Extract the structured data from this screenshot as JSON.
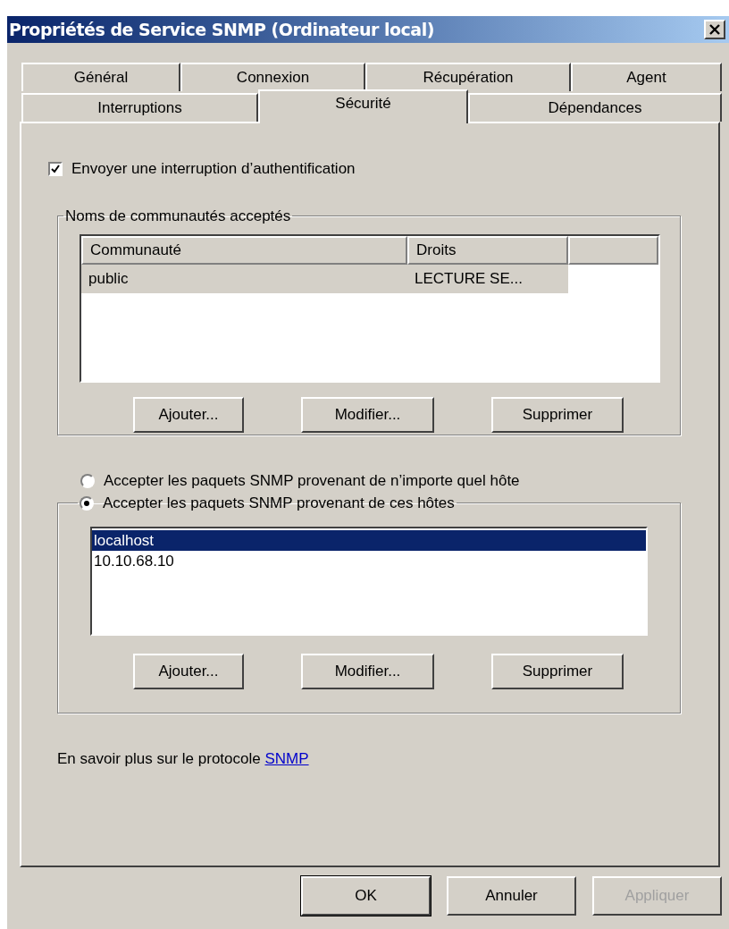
{
  "window": {
    "title": "Propriétés de Service SNMP (Ordinateur local)"
  },
  "tab_rows": [
    {
      "tabs": [
        {
          "label": "Général",
          "selected": false
        },
        {
          "label": "Connexion",
          "selected": false
        },
        {
          "label": "Récupération",
          "selected": false
        },
        {
          "label": "Agent",
          "selected": false
        }
      ]
    },
    {
      "tabs": [
        {
          "label": "Interruptions",
          "selected": false
        },
        {
          "label": "Sécurité",
          "selected": true
        },
        {
          "label": "Dépendances",
          "selected": false
        }
      ]
    }
  ],
  "auth_trap": {
    "label": "Envoyer une interruption d’authentification",
    "checked": true
  },
  "communities": {
    "title": "Noms de communautés acceptés",
    "columns": [
      "Communauté",
      "Droits"
    ],
    "rows": [
      {
        "cells": [
          "public",
          "LECTURE SE..."
        ],
        "selected": true
      }
    ],
    "buttons": [
      "Ajouter...",
      "Modifier...",
      "Supprimer"
    ]
  },
  "host_options": [
    {
      "label": "Accepter les paquets SNMP provenant de n’importe quel hôte",
      "selected": false
    },
    {
      "label": "Accepter les paquets SNMP provenant de ces hôtes",
      "selected": true
    }
  ],
  "hosts": {
    "items": [
      {
        "text": "localhost",
        "selected": true
      },
      {
        "text": "10.10.68.10",
        "selected": false
      }
    ],
    "buttons": [
      "Ajouter...",
      "Modifier...",
      "Supprimer"
    ]
  },
  "help": {
    "text": "En savoir plus sur le protocole ",
    "link": "SNMP"
  },
  "footer_buttons": [
    {
      "label": "OK",
      "disabled": false,
      "default": true
    },
    {
      "label": "Annuler",
      "disabled": false,
      "default": false
    },
    {
      "label": "Appliquer",
      "disabled": true,
      "default": false
    }
  ]
}
